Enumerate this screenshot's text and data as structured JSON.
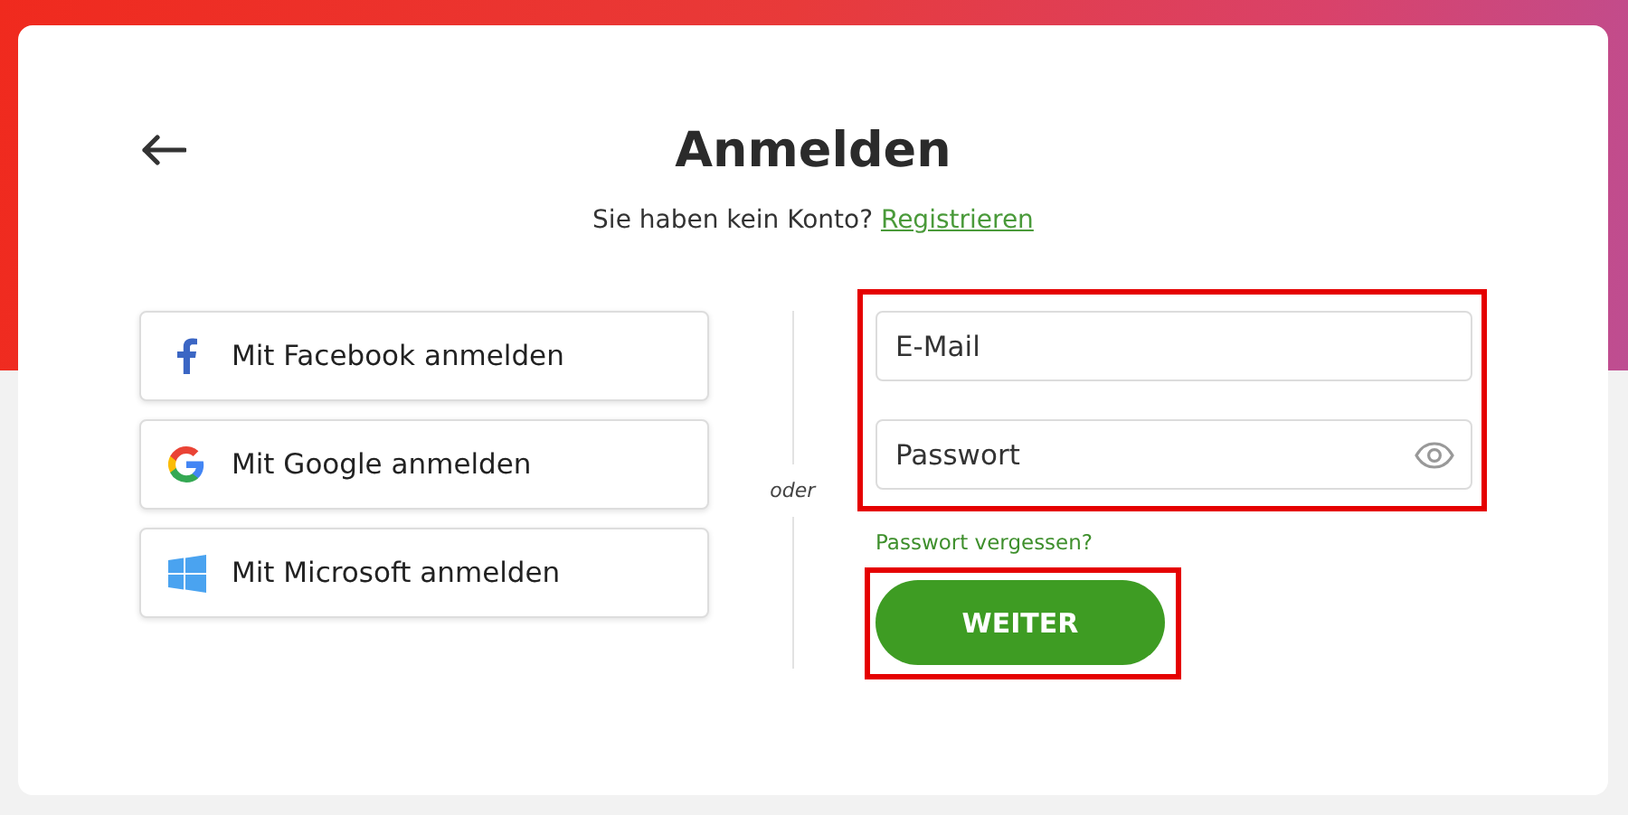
{
  "title": "Anmelden",
  "subtitle": {
    "text": "Sie haben kein Konto?",
    "link": "Registrieren"
  },
  "providers": [
    {
      "kind": "facebook",
      "label": "Mit Facebook anmelden"
    },
    {
      "kind": "google",
      "label": "Mit Google anmelden"
    },
    {
      "kind": "microsoft",
      "label": "Mit Microsoft anmelden"
    }
  ],
  "divider_label": "oder",
  "credentials": {
    "highlighted": true,
    "fields": [
      {
        "kind": "email",
        "placeholder": "E-Mail"
      },
      {
        "kind": "password",
        "placeholder": "Passwort"
      }
    ]
  },
  "forgot_link": "Passwort vergessen?",
  "submit": {
    "label": "WEITER",
    "highlighted": true
  }
}
